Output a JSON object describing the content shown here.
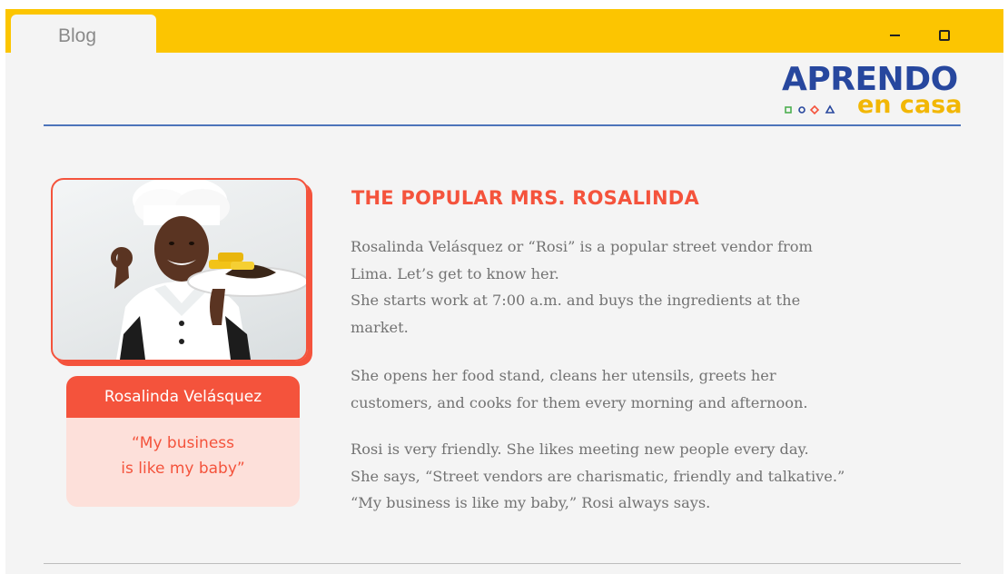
{
  "window": {
    "tab_label": "Blog",
    "accent_color": "#fcc501"
  },
  "logo": {
    "main": "APRENDO",
    "sub": "en casa",
    "main_color": "#27479e",
    "sub_color": "#f2b705"
  },
  "profile": {
    "name": "Rosalinda Velásquez",
    "quote": "“My business\nis like my baby”",
    "accent_color": "#f4533c"
  },
  "article": {
    "title": "THE POPULAR MRS. ROSALINDA",
    "paragraphs": [
      [
        "Rosalinda Velásquez or “Rosi” is a popular street vendor from",
        "Lima. Let’s get to know her.",
        "She starts work at 7:00 a.m. and buys the ingredients at the",
        "market."
      ],
      [
        "She opens her food stand, cleans her utensils, greets her",
        "customers, and cooks for them every morning and afternoon."
      ],
      [
        "Rosi is very friendly. She likes meeting new people every day.",
        "She says, “Street vendors are charismatic, friendly and talkative.”",
        "“My business is like my baby,” Rosi always says."
      ]
    ]
  },
  "icons": {
    "minimize": "minimize-icon",
    "maximize": "restore-icon"
  }
}
